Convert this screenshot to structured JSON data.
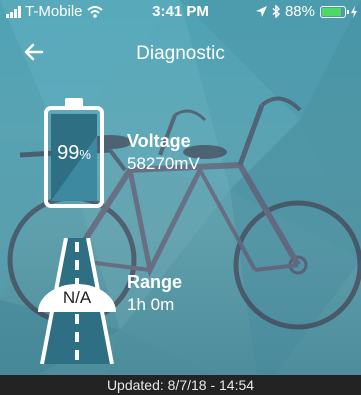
{
  "status_bar": {
    "carrier": "T-Mobile",
    "time": "3:41 PM",
    "battery_percent": "88%",
    "battery_level": 0.88,
    "icons": [
      "signal-icon",
      "wifi-icon",
      "location-arrow-icon",
      "bluetooth-icon",
      "battery-icon",
      "charging-icon"
    ]
  },
  "header": {
    "title": "Diagnostic",
    "back_icon": "back-arrow-icon"
  },
  "voltage": {
    "battery_percent": "99",
    "percent_sign": "%",
    "battery_level": 0.99,
    "title": "Voltage",
    "value": "58270mV"
  },
  "range": {
    "badge": "N/A",
    "title": "Range",
    "value": "1h 0m"
  },
  "footer": {
    "updated": "Updated: 8/7/18 - 14:54"
  },
  "colors": {
    "accent_teal": "#5aa3b3",
    "battery_green": "#4cd964",
    "footer_bg": "#232323",
    "battery_fill": "#2f6f84"
  }
}
